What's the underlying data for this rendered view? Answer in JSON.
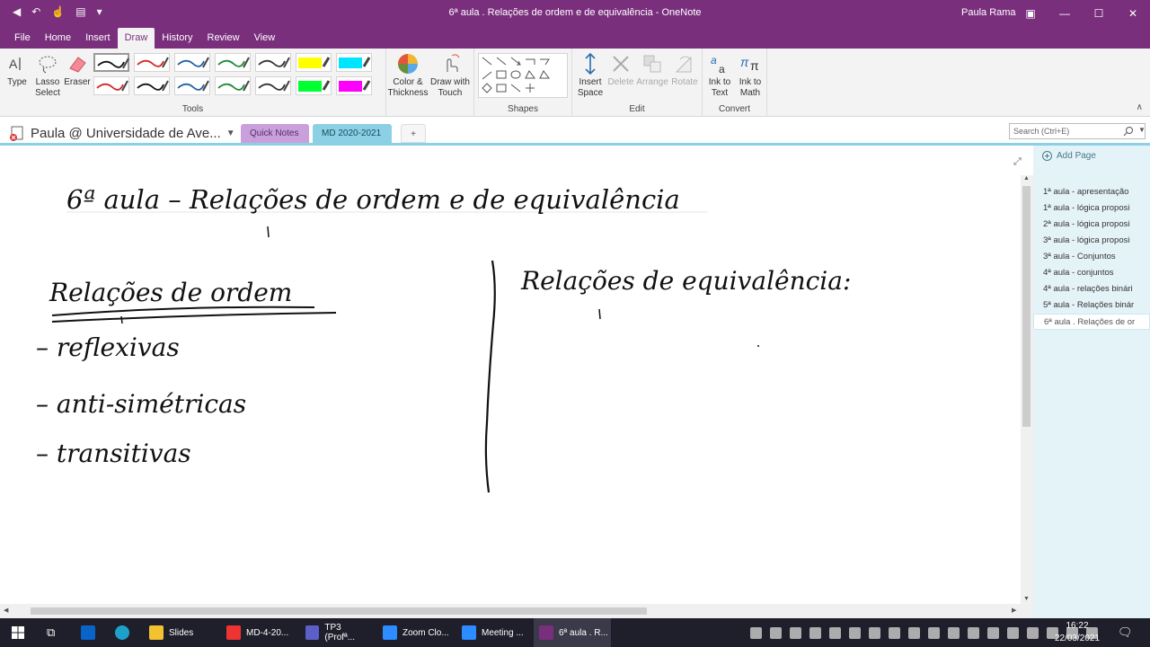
{
  "window": {
    "title": "6ª aula . Relações de ordem e de equivalência  -  OneNote",
    "user": "Paula Rama"
  },
  "ribbon_tabs": [
    "File",
    "Home",
    "Insert",
    "Draw",
    "History",
    "Review",
    "View"
  ],
  "ribbon": {
    "tools": {
      "type": "Type",
      "lasso": "Lasso Select",
      "eraser": "Eraser",
      "group": "Tools"
    },
    "color_thickness": "Color & Thickness",
    "draw_touch": "Draw with Touch",
    "shapes_group": "Shapes",
    "edit": {
      "insert_space": "Insert Space",
      "delete": "Delete",
      "arrange": "Arrange",
      "rotate": "Rotate",
      "group": "Edit"
    },
    "convert": {
      "ink_text": "Ink to Text",
      "ink_math": "Ink to Math",
      "group": "Convert"
    }
  },
  "pens": [
    {
      "color": "#111111"
    },
    {
      "color": "#d42424"
    },
    {
      "color": "#1f5fa8"
    },
    {
      "color": "#1d8a3a"
    },
    {
      "color": "#333333"
    },
    {
      "color": "#ffff00"
    },
    {
      "color": "#00e5ff"
    },
    {
      "color": "#d42424"
    },
    {
      "color": "#111111"
    },
    {
      "color": "#1f5fa8"
    },
    {
      "color": "#1d8a3a"
    },
    {
      "color": "#333333"
    },
    {
      "color": "#00ff33"
    },
    {
      "color": "#ff00ff"
    }
  ],
  "notebook": {
    "name": "Paula @ Universidade de Ave...",
    "sections": {
      "quick": "Quick Notes",
      "md": "MD 2020-2021",
      "add": "+"
    },
    "search_placeholder": "Search (Ctrl+E)"
  },
  "pages": {
    "add_label": "Add Page",
    "items": [
      "1ª aula - apresentação",
      "1ª aula - lógica proposi",
      "2ª aula - lógica proposi",
      "3ª aula - lógica proposi",
      "3ª aula - Conjuntos",
      "4ª aula - conjuntos",
      "4ª aula - relações binári",
      "5ª aula - Relações binár",
      "6ª aula . Relações de or"
    ]
  },
  "ink": {
    "title": "6ª aula – Relações de ordem e de equivalência",
    "left_heading": "Relações de ordem",
    "left_items": [
      "– reflexivas",
      "– anti-simétricas",
      "– transitivas"
    ],
    "right_heading": "Relações de equivalência:"
  },
  "taskbar": {
    "items": [
      "Slides",
      "MD-4-20...",
      "TP3 (Profª...",
      "Zoom Clo...",
      "Meeting ...",
      "6ª aula . R..."
    ],
    "time": "16:22",
    "date": "22/03/2021"
  }
}
